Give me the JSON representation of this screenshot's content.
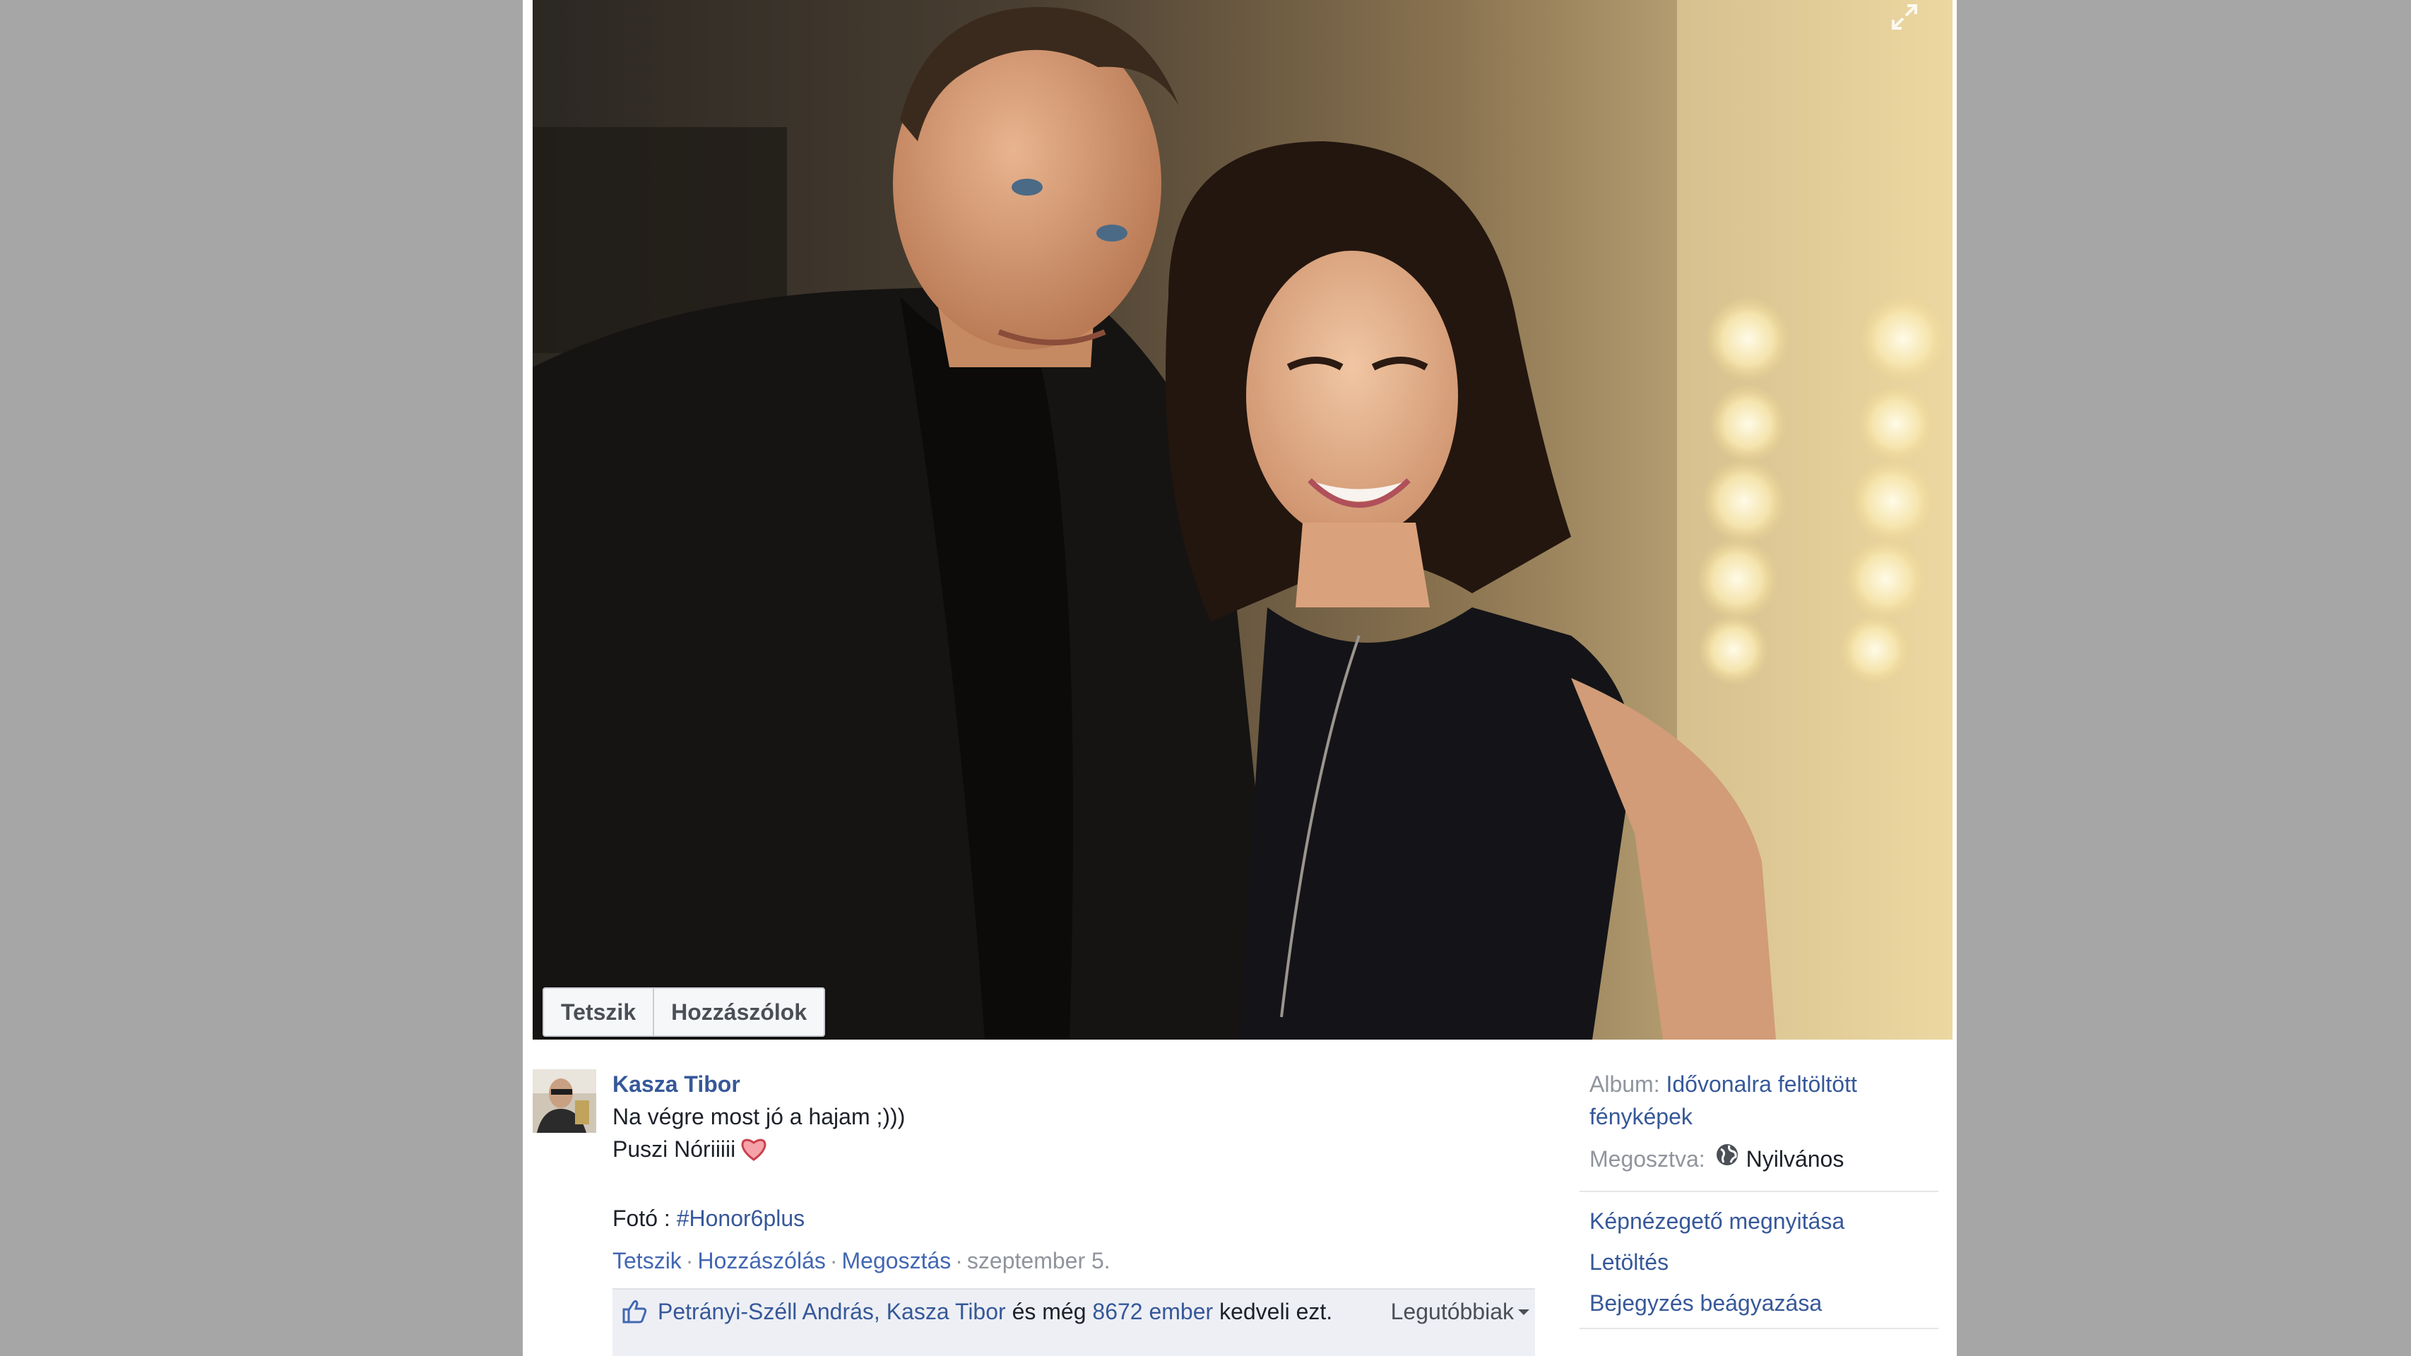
{
  "photo": {
    "alt": "",
    "actions": {
      "like_label": "Tetszik",
      "comment_label": "Hozzászólok"
    }
  },
  "post": {
    "author": "Kasza Tibor",
    "text_line1": "Na végre most jó a hajam ;)))",
    "text_line2": "Puszi Nóriiiii",
    "photo_credit_prefix": "Fotó : ",
    "hashtag": "#Honor6plus",
    "meta": {
      "like": "Tetszik",
      "comment": "Hozzászólás",
      "share": "Megosztás",
      "date": "szeptember 5."
    },
    "likes": {
      "names": "Petrányi-Széll András, Kasza Tibor",
      "and_more": " és még ",
      "count_link": "8672 ember",
      "suffix": " kedveli ezt.",
      "sort_label": "Legutóbbiak"
    }
  },
  "sidebar": {
    "album_label": "Album:",
    "album_name": "Idővonalra feltöltött fényképek",
    "shared_label": "Megosztva:",
    "privacy": "Nyilvános",
    "actions": {
      "open_viewer": "Képnézegető megnyitása",
      "download": "Letöltés",
      "embed": "Bejegyzés beágyazása"
    }
  },
  "colors": {
    "link": "#365899",
    "page_bg": "#a6a6a6",
    "panel_bg": "#ffffff",
    "likes_bg": "#edeff4"
  }
}
